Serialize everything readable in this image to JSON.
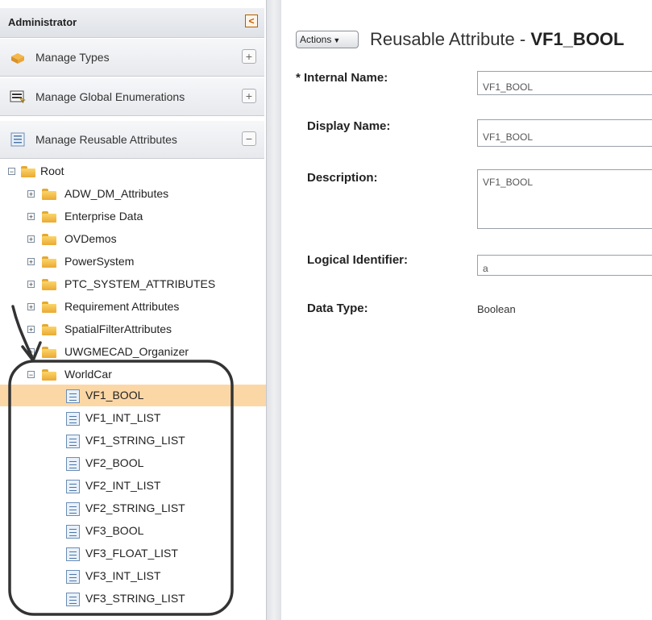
{
  "sidebar": {
    "title": "Administrator",
    "collapse_glyph": "<",
    "sections": [
      {
        "label": "Manage Types",
        "icon": "box-icon",
        "toggle": "+"
      },
      {
        "label": "Manage Global Enumerations",
        "icon": "enumeration-icon",
        "toggle": "+"
      },
      {
        "label": "Manage Reusable Attributes",
        "icon": "attribute-list-icon",
        "toggle": "−"
      }
    ]
  },
  "tree": {
    "root_label": "Root",
    "folders": [
      "ADW_DM_Attributes",
      "Enterprise Data",
      "OVDemos",
      "PowerSystem",
      "PTC_SYSTEM_ATTRIBUTES",
      "Requirement Attributes",
      "SpatialFilterAttributes",
      "UWGMECAD_Organizer"
    ],
    "open_folder": "WorldCar",
    "attributes": [
      "VF1_BOOL",
      "VF1_INT_LIST",
      "VF1_STRING_LIST",
      "VF2_BOOL",
      "VF2_INT_LIST",
      "VF2_STRING_LIST",
      "VF3_BOOL",
      "VF3_FLOAT_LIST",
      "VF3_INT_LIST",
      "VF3_STRING_LIST"
    ],
    "selected": "VF1_BOOL",
    "expand_plus": "+",
    "expand_minus": "−"
  },
  "detail": {
    "actions_label": "Actions",
    "title_prefix": "Reusable Attribute - ",
    "title_name": "VF1_BOOL",
    "fields": {
      "internal_name_label": "* Internal Name:",
      "internal_name_value": "VF1_BOOL",
      "display_name_label": "Display Name:",
      "display_name_value": "VF1_BOOL",
      "description_label": "Description:",
      "description_value": "VF1_BOOL",
      "logical_id_label": "Logical Identifier:",
      "logical_id_value": "a",
      "data_type_label": "Data Type:",
      "data_type_value": "Boolean"
    }
  },
  "colors": {
    "selection": "#fcd7a6",
    "folder": "#f3c04f",
    "collapse_button": "#c25a00"
  }
}
